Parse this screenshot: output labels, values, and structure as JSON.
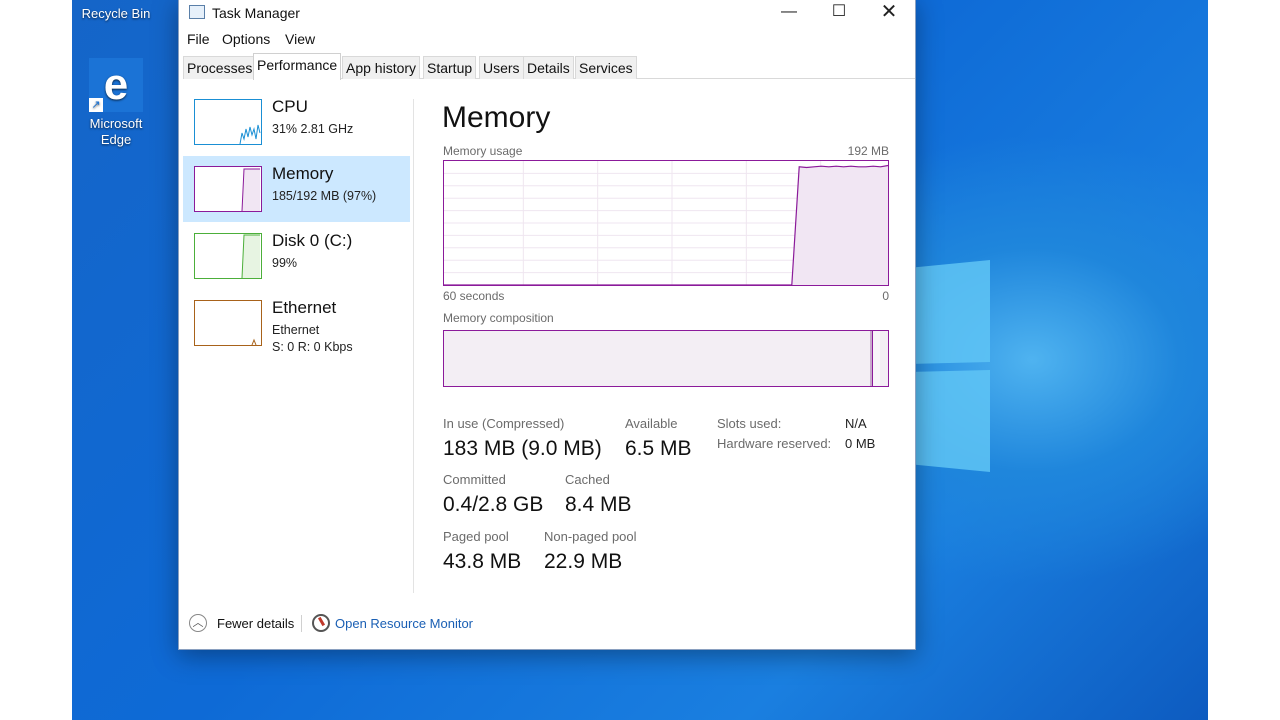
{
  "desktop": {
    "icons": [
      {
        "label": "Recycle Bin"
      },
      {
        "label_line1": "Microsoft",
        "label_line2": "Edge"
      }
    ]
  },
  "window": {
    "title": "Task Manager",
    "controls": {
      "minimize": "—",
      "maximize": "☐",
      "close": "✕"
    }
  },
  "menu": [
    "File",
    "Options",
    "View"
  ],
  "tabs": [
    "Processes",
    "Performance",
    "App history",
    "Startup",
    "Users",
    "Details",
    "Services"
  ],
  "active_tab": "Performance",
  "sidebar": [
    {
      "title": "CPU",
      "sub": "31%  2.81 GHz",
      "color": "#1a8fd4"
    },
    {
      "title": "Memory",
      "sub": "185/192 MB (97%)",
      "color": "#8b1a9a",
      "selected": true
    },
    {
      "title": "Disk 0 (C:)",
      "sub": "99%",
      "color": "#4caf3a"
    },
    {
      "title": "Ethernet",
      "sub": "Ethernet",
      "sub2": "S: 0  R: 0 Kbps",
      "color": "#a8621a"
    }
  ],
  "main": {
    "title": "Memory",
    "usage_label": "Memory usage",
    "usage_max": "192 MB",
    "time_left": "60 seconds",
    "time_right": "0",
    "composition_label": "Memory composition"
  },
  "stats": {
    "in_use_label": "In use (Compressed)",
    "in_use_value": "183 MB (9.0 MB)",
    "available_label": "Available",
    "available_value": "6.5 MB",
    "slots_label": "Slots used:",
    "slots_value": "N/A",
    "hw_label": "Hardware reserved:",
    "hw_value": "0 MB",
    "committed_label": "Committed",
    "committed_value": "0.4/2.8 GB",
    "cached_label": "Cached",
    "cached_value": "8.4 MB",
    "paged_label": "Paged pool",
    "paged_value": "43.8 MB",
    "nonpaged_label": "Non-paged pool",
    "nonpaged_value": "22.9 MB"
  },
  "footer": {
    "fewer_details": "Fewer details",
    "open_resource_monitor": "Open Resource Monitor"
  },
  "colors": {
    "memory": "#8b1a9a",
    "selection": "#cce8ff",
    "link": "#1a5fb4"
  },
  "chart_data": {
    "type": "area",
    "ylim": [
      0,
      192
    ],
    "x": [
      60,
      58,
      56,
      54,
      52,
      50,
      48,
      46,
      44,
      42,
      40,
      38,
      36,
      34,
      32,
      30,
      28,
      26,
      24,
      22,
      20,
      18,
      16,
      14,
      13,
      12,
      11,
      10,
      9,
      8,
      7,
      6,
      5,
      4,
      3,
      2,
      1,
      0
    ],
    "values": [
      0,
      0,
      0,
      0,
      0,
      0,
      0,
      0,
      0,
      0,
      0,
      0,
      0,
      0,
      0,
      0,
      0,
      0,
      0,
      0,
      0,
      0,
      0,
      0,
      0,
      183,
      182,
      183,
      184,
      183,
      184,
      183,
      184,
      183,
      183,
      184,
      183,
      185
    ]
  }
}
